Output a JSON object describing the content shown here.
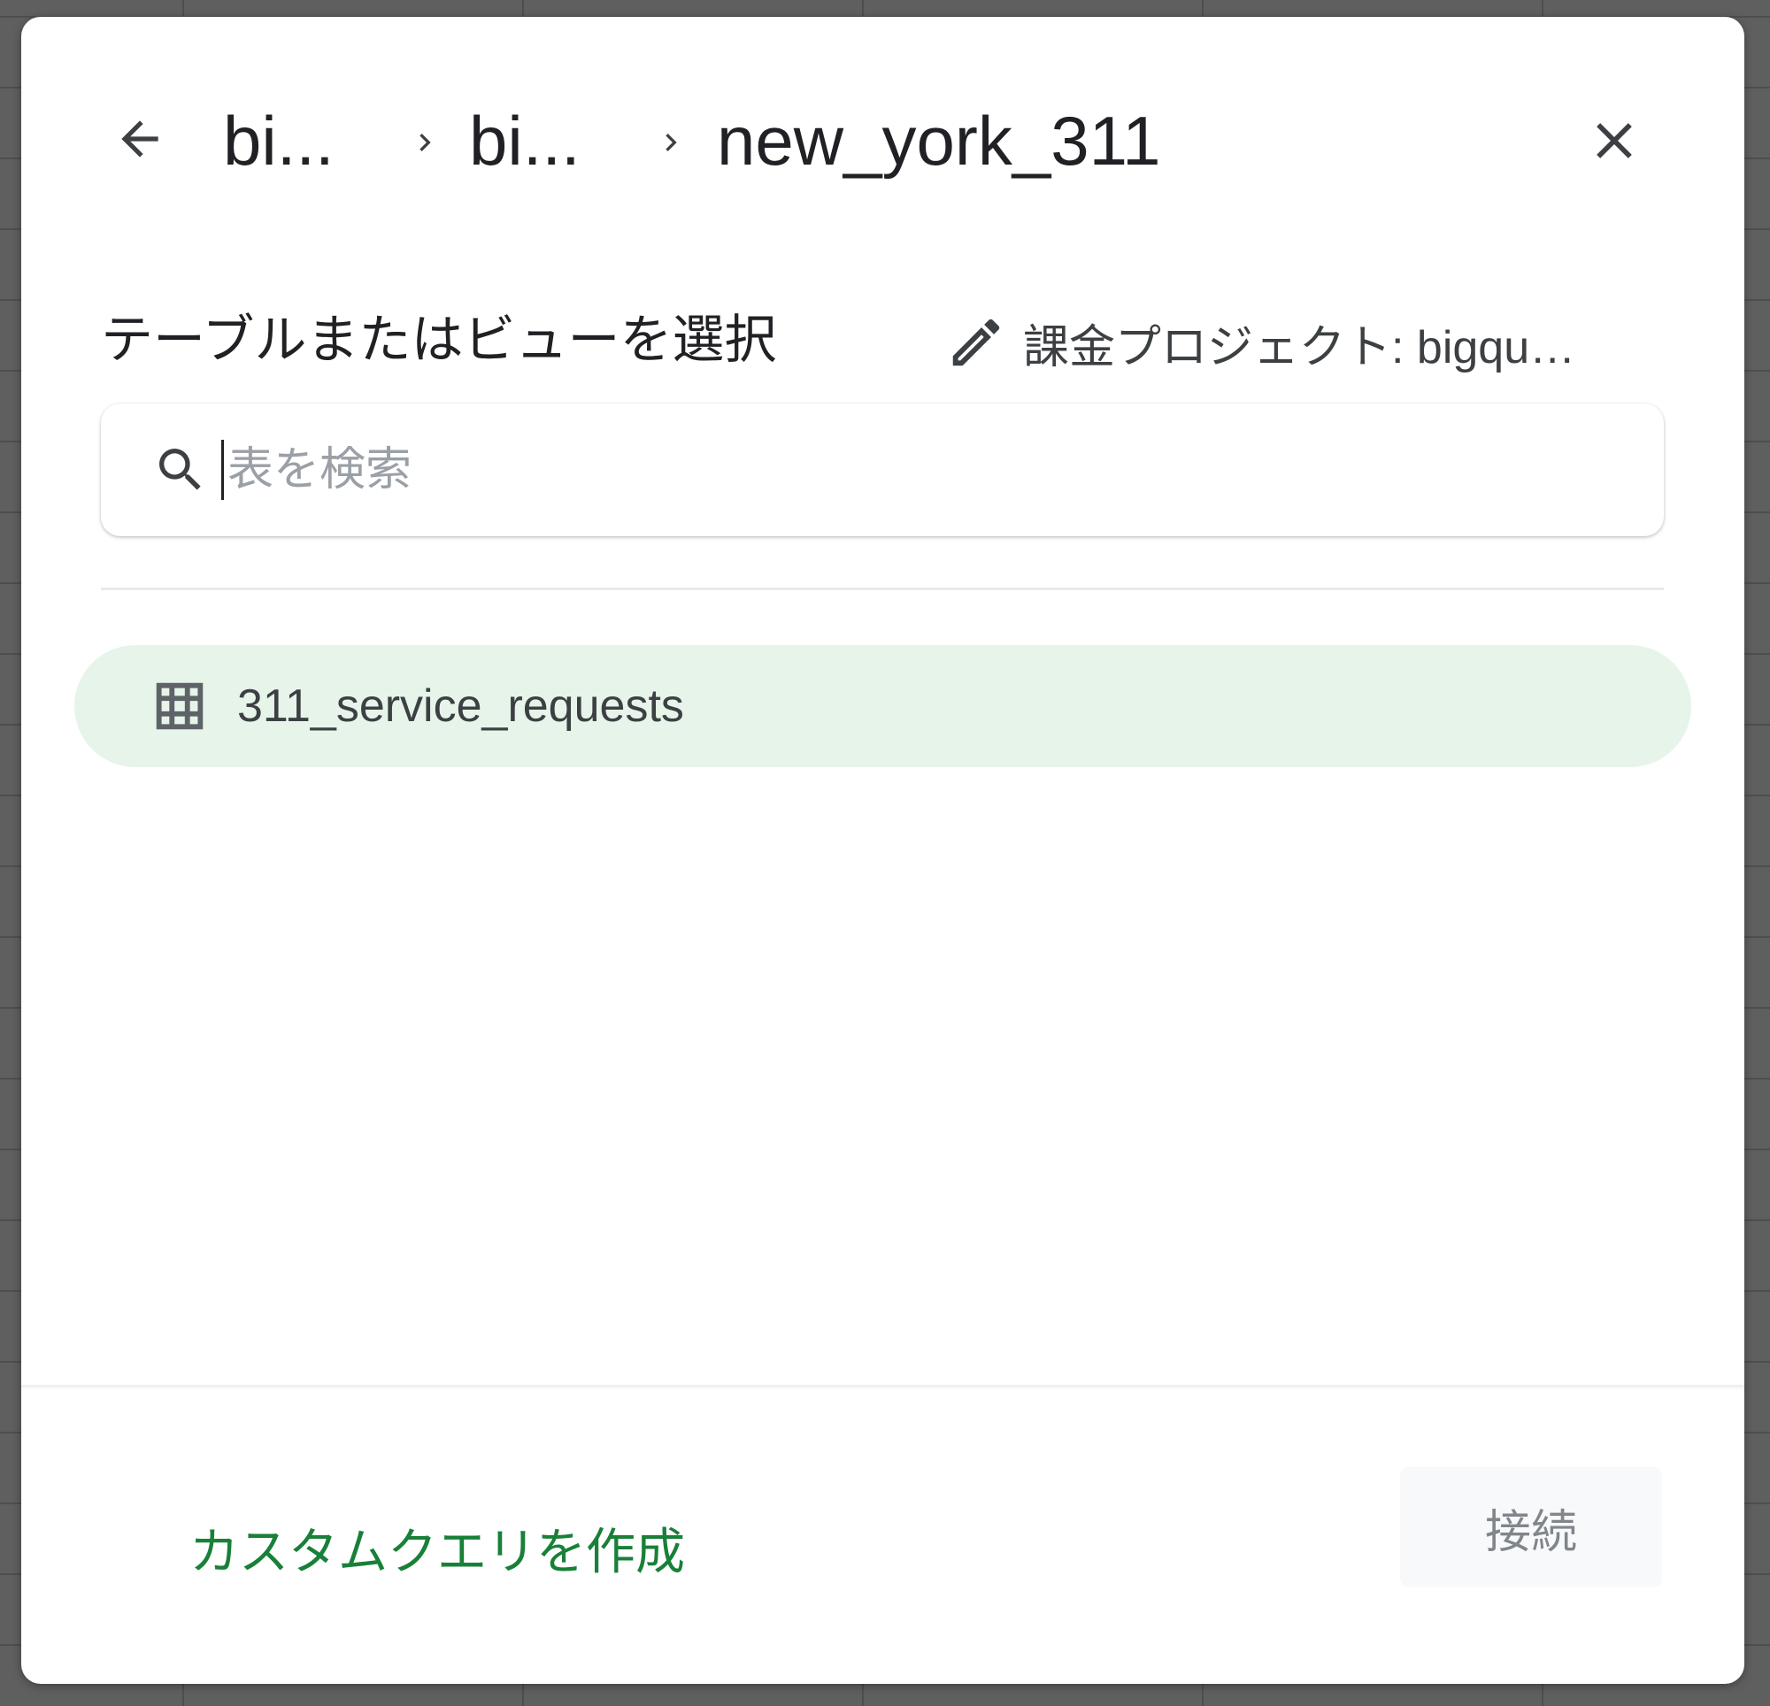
{
  "dialog": {
    "breadcrumb": {
      "items": [
        "bi...",
        "bi...",
        "new_york_311"
      ],
      "separator_icon": "chevron-right-icon"
    },
    "back_icon": "arrow-left-icon",
    "close_icon": "close-icon",
    "section_title": "テーブルまたはビューを選択",
    "billing": {
      "icon": "pencil-icon",
      "label": "課金プロジェクト: bigquer..."
    },
    "search": {
      "icon": "search-icon",
      "placeholder": "表を検索",
      "value": ""
    },
    "tables": [
      {
        "icon": "table-grid-icon",
        "label": "311_service_requests",
        "selected": true
      }
    ],
    "footer": {
      "custom_query_label": "カスタムクエリを作成",
      "connect_label": "接続",
      "connect_enabled": false
    }
  },
  "colors": {
    "accent": "#188038",
    "selected_row_bg": "#e6f4ea",
    "text": "#202124",
    "icon": "#5f6368"
  }
}
